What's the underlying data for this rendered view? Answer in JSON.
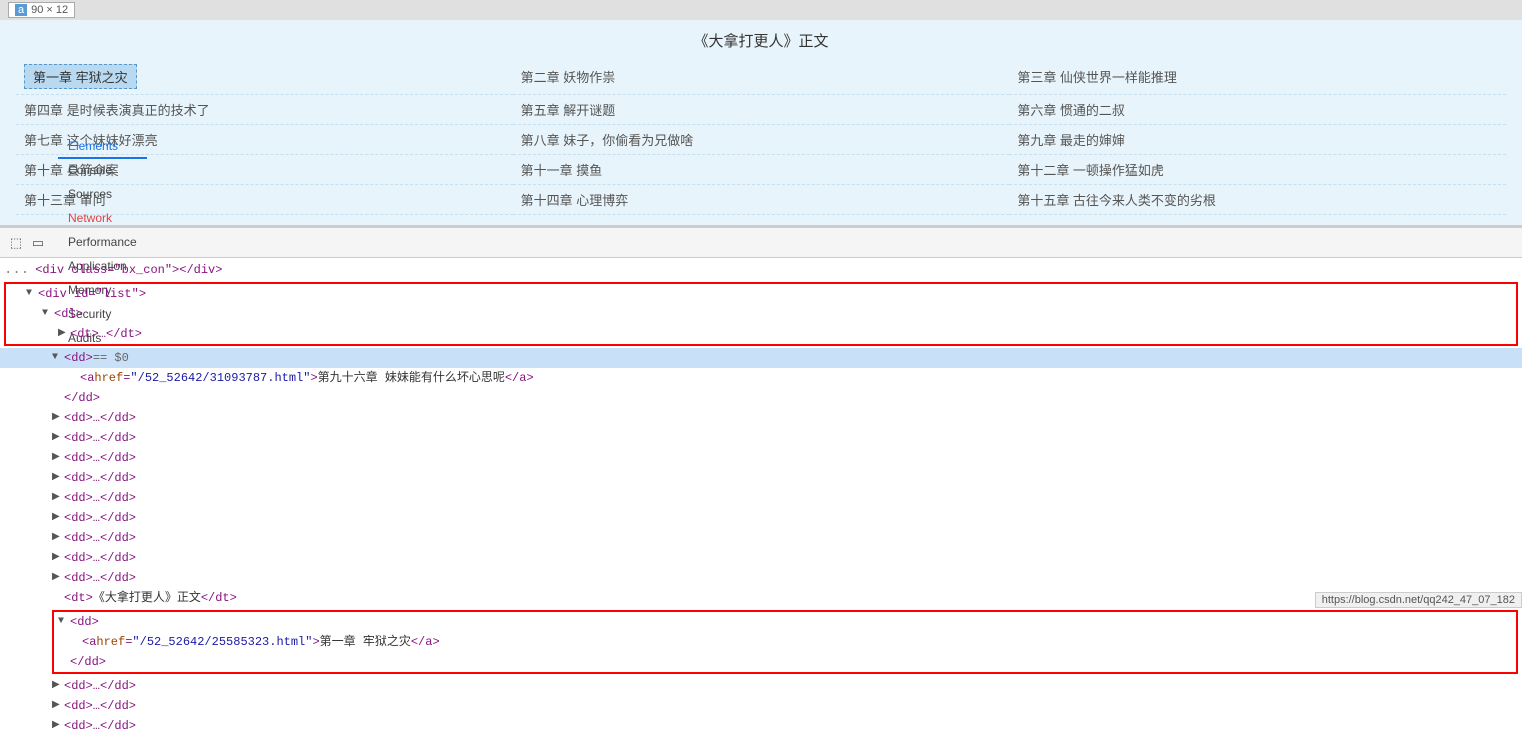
{
  "tooltip": {
    "letter": "a",
    "dimensions": "90 × 12",
    "selected_chapter": "第一章  牢狱之灾"
  },
  "book": {
    "title": "《大拿打更人》正文",
    "chapters": [
      [
        "第一章  牢狱之灾",
        "第二章  妖物作祟",
        "第三章  仙侠世界一样能推理"
      ],
      [
        "第四章  是时候表演真正的技术了",
        "第五章  解开谜题",
        "第六章  惯通的二叔"
      ],
      [
        "第七章  这个妹妹好漂亮",
        "第八章  妹子，你偷看为兄做啥",
        "第九章  最走的婶婶"
      ],
      [
        "第十章  县箭命案",
        "第十一章  摸鱼",
        "第十二章  一顿操作猛如虎"
      ],
      [
        "第十三章  审问",
        "第十四章  心理博弈",
        "第十五章  古往今来人类不变的劣根"
      ]
    ]
  },
  "devtools": {
    "tabs": [
      "Elements",
      "Console",
      "Sources",
      "Network",
      "Performance",
      "Application",
      "Memory",
      "Security",
      "Audits"
    ]
  },
  "code": {
    "lines": [
      {
        "indent": 1,
        "triangle": "open",
        "content": "<div class=\"bx_con\">...</div>",
        "type": "tag"
      },
      {
        "indent": 2,
        "triangle": "open",
        "content": "<div id=\"list\">",
        "type": "tag",
        "redbox": true
      },
      {
        "indent": 3,
        "triangle": "open",
        "content": "<dl>",
        "type": "tag",
        "redbox": true
      },
      {
        "indent": 4,
        "triangle": "closed",
        "content": "<dt>…</dt>",
        "type": "tag",
        "redbox": true
      },
      {
        "indent": 4,
        "triangle": "open",
        "content": "<dd> == $0",
        "type": "tag",
        "selected": true
      },
      {
        "indent": 5,
        "triangle": "none",
        "content": "<a href=\"/52_52642/31093787.html\">第九十六章 妹妹能有什么坏心思呢</a>",
        "type": "link"
      },
      {
        "indent": 4,
        "triangle": "none",
        "content": "</dd>",
        "type": "tag"
      },
      {
        "indent": 4,
        "triangle": "closed",
        "content": "<dd>…</dd>",
        "type": "tag"
      },
      {
        "indent": 4,
        "triangle": "closed",
        "content": "<dd>…</dd>",
        "type": "tag"
      },
      {
        "indent": 4,
        "triangle": "closed",
        "content": "<dd>…</dd>",
        "type": "tag"
      },
      {
        "indent": 4,
        "triangle": "closed",
        "content": "<dd>…</dd>",
        "type": "tag"
      },
      {
        "indent": 4,
        "triangle": "closed",
        "content": "<dd>…</dd>",
        "type": "tag"
      },
      {
        "indent": 4,
        "triangle": "closed",
        "content": "<dd>…</dd>",
        "type": "tag"
      },
      {
        "indent": 4,
        "triangle": "closed",
        "content": "<dd>…</dd>",
        "type": "tag"
      },
      {
        "indent": 4,
        "triangle": "closed",
        "content": "<dd>…</dd>",
        "type": "tag"
      },
      {
        "indent": 4,
        "triangle": "none",
        "content": "<dt>《大拿打更人》正文</dt>",
        "type": "tag"
      },
      {
        "indent": 4,
        "triangle": "open",
        "content": "<dd>",
        "type": "tag",
        "redbox2": true
      },
      {
        "indent": 5,
        "triangle": "none",
        "content": "<a href=\"/52_52642/25585323.html\">第一章  牢狱之灾</a>",
        "type": "link",
        "redbox2": true
      },
      {
        "indent": 4,
        "triangle": "none",
        "content": "</dd>",
        "type": "tag",
        "redbox2": true
      },
      {
        "indent": 4,
        "triangle": "closed",
        "content": "<dd>…</dd>",
        "type": "tag"
      },
      {
        "indent": 4,
        "triangle": "closed",
        "content": "<dd>…</dd>",
        "type": "tag"
      },
      {
        "indent": 4,
        "triangle": "closed",
        "content": "<dd>…</dd>",
        "type": "tag"
      }
    ]
  },
  "url_bar": "https://blog.csdn.net/qq242_47_07_182"
}
